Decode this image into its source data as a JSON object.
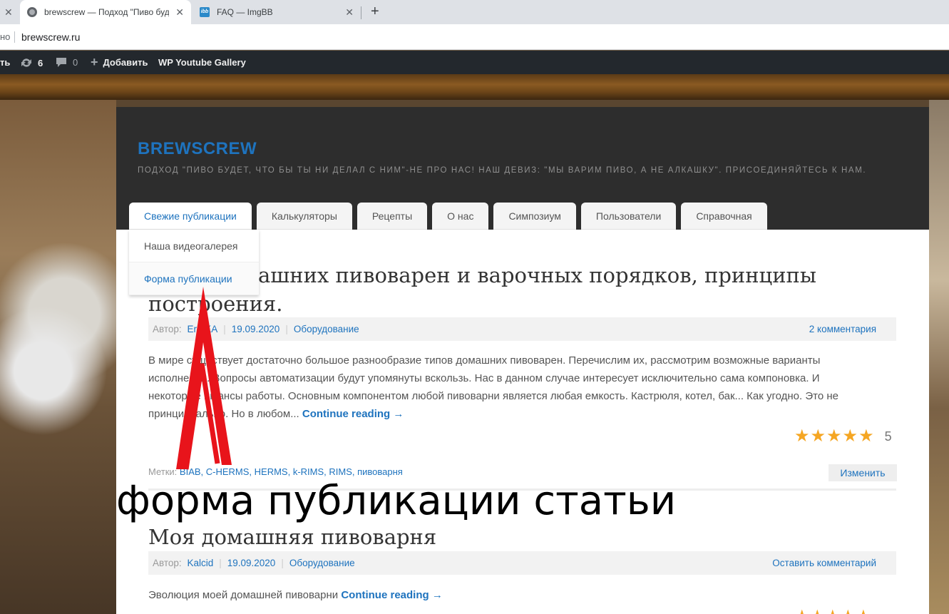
{
  "browser": {
    "tabs": [
      {
        "title": "brewscrew — Подход \"Пиво буде",
        "active": true
      },
      {
        "title": "FAQ — ImgBB",
        "active": false
      }
    ],
    "address_left": "но",
    "url": "brewscrew.ru"
  },
  "wpbar": {
    "left_cut": "ть",
    "updates": "6",
    "comments": "0",
    "add_label": "Добавить",
    "gallery_label": "WP Youtube Gallery"
  },
  "site": {
    "title": "BREWSCREW",
    "description": "Подход \"Пиво будет, что бы ты ни делал с ним\"-не про нас! Наш девиз: \"Мы варим пиво, а не алкашку\". Присоединяйтесь к нам."
  },
  "nav": {
    "items": [
      "Свежие публикации",
      "Калькуляторы",
      "Рецепты",
      "О нас",
      "Симпозиум",
      "Пользователи",
      "Справочная"
    ],
    "dropdown": [
      "Наша видеогалерея",
      "Форма публикации"
    ]
  },
  "post1": {
    "title_line1": "ашних пивоварен и варочных порядков, принципы",
    "title_line2": "построения.",
    "meta_prefix": "Автор:",
    "author": "ErofKA",
    "date": "19.09.2020",
    "category": "Оборудование",
    "comments": "2 комментария",
    "excerpt_lines": [
      "В мире существует достаточно большое разнообразие типов домашних пивоварен. Перечислим их, рассмотрим возможные варианты",
      "исполнения. Вопросы автоматизации будут упомянуты вскользь. Нас в данном случае интересует исключительно сама компоновка. И",
      "некоторые нюансы работы. Основным компонентом любой пивоварни является любая емкость. Кастрюля, котел, бак... Как угодно. Это не",
      "принципиально. Но в любом..."
    ],
    "more": "Continue reading →",
    "rating": "5",
    "tags_label": "Метки:",
    "tags": "BIAB, C-HERMS, HERMS, k-RIMS, RIMS, пивоварня",
    "edit": "Изменить"
  },
  "annotation": "форма публикации статьи",
  "post2": {
    "title": "Моя домашняя пивоварня",
    "meta_prefix": "Автор:",
    "author": "Kalcid",
    "date": "19.09.2020",
    "category": "Оборудование",
    "comments": "Оставить комментарий",
    "excerpt": "Эволюция моей домашней пивоварни",
    "more": "Continue reading →"
  },
  "colors": {
    "accent": "#1e73be",
    "star": "#f5a623",
    "arrow": "#e8141b"
  }
}
